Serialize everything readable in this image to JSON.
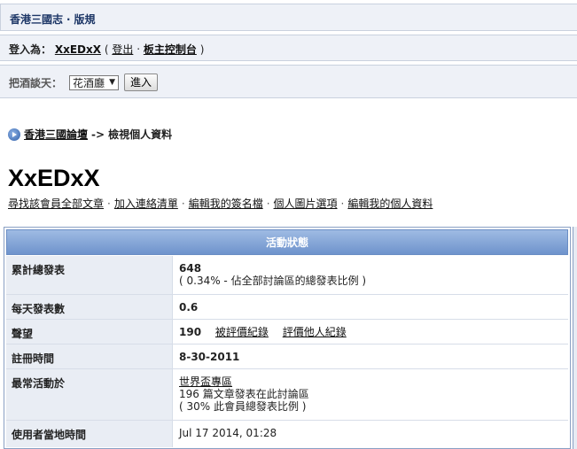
{
  "site": {
    "title": "香港三國志 ‧ 版規"
  },
  "login": {
    "prefix": "登入為：",
    "username": "XxEDxX",
    "open_paren": "(",
    "logout": "登出",
    "dot": "‧",
    "admin_panel": "板主控制台",
    "close_paren": ")"
  },
  "forum_jump": {
    "label": "把酒談天：",
    "selected": "花酒廳",
    "button": "進入"
  },
  "breadcrumb": {
    "home": "香港三國論壇",
    "arrow": "->",
    "current": "檢視個人資料"
  },
  "profile": {
    "username": "XxEDxX",
    "links": [
      "尋找該會員全部文章",
      "加入連絡清單",
      "編輯我的簽名檔",
      "個人圖片選項",
      "編輯我的個人資料"
    ]
  },
  "stats": {
    "title": "活動狀態",
    "total_posts_label": "累計總發表",
    "total_posts": "648",
    "total_posts_note": "( 0.34% - 佔全部討論區的總發表比例 )",
    "daily_label": "每天發表數",
    "daily": "0.6",
    "rep_label": "聲望",
    "rep": "190",
    "rep_link1": "被評價紀錄",
    "rep_link2": "評價他人紀錄",
    "reg_label": "註冊時間",
    "reg": "8-30-2011",
    "active_label": "最常活動於",
    "active_forum": "世界盃專區",
    "active_posts": "196 篇文章發表在此討論區",
    "active_pct": "( 30% 此會員總發表比例 )",
    "localtime_label": "使用者當地時間",
    "localtime": "Jul 17 2014, 01:28"
  },
  "colors": {
    "header_blue": "#6e93cc",
    "bar_bg": "#eef1f7",
    "label_bg": "#e9edf4"
  }
}
